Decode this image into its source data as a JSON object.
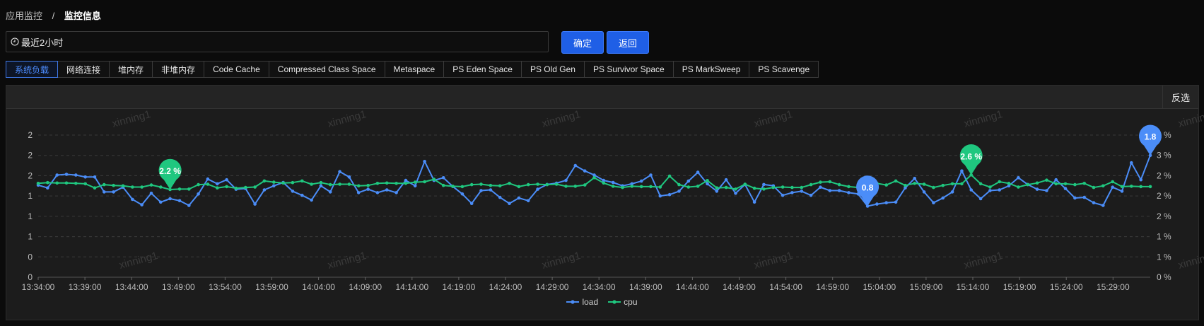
{
  "breadcrumb": {
    "parent": "应用监控",
    "separator": "/",
    "current": "监控信息"
  },
  "time_range": {
    "value": "最近2小时"
  },
  "buttons": {
    "confirm": "确定",
    "back": "返回"
  },
  "tabs": [
    {
      "label": "系统负载",
      "active": true
    },
    {
      "label": "网络连接"
    },
    {
      "label": "堆内存"
    },
    {
      "label": "非堆内存"
    },
    {
      "label": "Code Cache"
    },
    {
      "label": "Compressed Class Space"
    },
    {
      "label": "Metaspace"
    },
    {
      "label": "PS Eden Space"
    },
    {
      "label": "PS Old Gen"
    },
    {
      "label": "PS Survivor Space"
    },
    {
      "label": "PS MarkSweep"
    },
    {
      "label": "PS Scavenge"
    }
  ],
  "panel": {
    "invert_label": "反选"
  },
  "watermark": "xinning1",
  "chart_data": {
    "type": "line",
    "x_tick_labels": [
      "13:34:00",
      "13:39:00",
      "13:44:00",
      "13:49:00",
      "13:54:00",
      "13:59:00",
      "14:04:00",
      "14:09:00",
      "14:14:00",
      "14:19:00",
      "14:24:00",
      "14:29:00",
      "14:34:00",
      "14:39:00",
      "14:44:00",
      "14:49:00",
      "14:54:00",
      "14:59:00",
      "15:04:00",
      "15:09:00",
      "15:14:00",
      "15:19:00",
      "15:24:00",
      "15:29:00"
    ],
    "y_left_ticks": [
      "0",
      "0",
      "1",
      "1",
      "1",
      "2",
      "2",
      "2"
    ],
    "y_right_ticks": [
      "0 %",
      "1 %",
      "1 %",
      "2 %",
      "2 %",
      "2 %",
      "3 %",
      "3 %"
    ],
    "y_left_range": [
      0,
      2.1
    ],
    "y_right_range": [
      0,
      3.5
    ],
    "grid": true,
    "legend_position": "bottom-center",
    "series": [
      {
        "name": "load",
        "axis": "left",
        "color": "#4b8df8",
        "values": [
          1.36,
          1.32,
          1.51,
          1.52,
          1.51,
          1.48,
          1.48,
          1.26,
          1.26,
          1.33,
          1.15,
          1.07,
          1.24,
          1.11,
          1.16,
          1.13,
          1.06,
          1.23,
          1.45,
          1.38,
          1.44,
          1.3,
          1.31,
          1.08,
          1.29,
          1.35,
          1.4,
          1.27,
          1.21,
          1.14,
          1.35,
          1.26,
          1.56,
          1.48,
          1.25,
          1.3,
          1.25,
          1.29,
          1.25,
          1.43,
          1.35,
          1.71,
          1.43,
          1.47,
          1.34,
          1.23,
          1.09,
          1.28,
          1.29,
          1.18,
          1.09,
          1.17,
          1.13,
          1.3,
          1.37,
          1.39,
          1.43,
          1.65,
          1.57,
          1.51,
          1.43,
          1.4,
          1.35,
          1.38,
          1.42,
          1.51,
          1.2,
          1.22,
          1.27,
          1.42,
          1.55,
          1.38,
          1.27,
          1.44,
          1.24,
          1.37,
          1.11,
          1.37,
          1.35,
          1.21,
          1.25,
          1.27,
          1.21,
          1.33,
          1.28,
          1.28,
          1.25,
          1.23,
          1.05,
          1.08,
          1.1,
          1.11,
          1.32,
          1.46,
          1.26,
          1.1,
          1.17,
          1.26,
          1.57,
          1.29,
          1.16,
          1.28,
          1.29,
          1.35,
          1.47,
          1.37,
          1.3,
          1.28,
          1.44,
          1.31,
          1.17,
          1.18,
          1.1,
          1.06,
          1.33,
          1.27,
          1.69,
          1.44,
          1.8
        ]
      },
      {
        "name": "cpu",
        "axis": "right",
        "color": "#1fc77f",
        "values": [
          2.31,
          2.33,
          2.32,
          2.32,
          2.31,
          2.3,
          2.2,
          2.28,
          2.26,
          2.25,
          2.22,
          2.22,
          2.27,
          2.22,
          2.16,
          2.17,
          2.17,
          2.28,
          2.29,
          2.2,
          2.23,
          2.19,
          2.21,
          2.22,
          2.37,
          2.34,
          2.32,
          2.33,
          2.37,
          2.29,
          2.33,
          2.28,
          2.29,
          2.29,
          2.25,
          2.26,
          2.31,
          2.32,
          2.31,
          2.31,
          2.34,
          2.35,
          2.41,
          2.26,
          2.24,
          2.23,
          2.28,
          2.29,
          2.26,
          2.25,
          2.31,
          2.23,
          2.28,
          2.29,
          2.28,
          2.29,
          2.24,
          2.24,
          2.27,
          2.45,
          2.32,
          2.24,
          2.21,
          2.24,
          2.23,
          2.23,
          2.22,
          2.49,
          2.28,
          2.22,
          2.24,
          2.38,
          2.2,
          2.21,
          2.17,
          2.29,
          2.19,
          2.17,
          2.21,
          2.22,
          2.21,
          2.21,
          2.28,
          2.34,
          2.35,
          2.28,
          2.23,
          2.21,
          2.21,
          2.31,
          2.27,
          2.37,
          2.26,
          2.31,
          2.29,
          2.21,
          2.26,
          2.3,
          2.3,
          2.52,
          2.3,
          2.22,
          2.35,
          2.31,
          2.22,
          2.28,
          2.32,
          2.39,
          2.3,
          2.3,
          2.28,
          2.31,
          2.21,
          2.25,
          2.35,
          2.23,
          2.24,
          2.23,
          2.23
        ]
      }
    ],
    "markers": [
      {
        "series": "cpu",
        "type": "max",
        "label": "2.6 %"
      },
      {
        "series": "cpu",
        "type": "min",
        "label": "2.2 %"
      },
      {
        "series": "load",
        "type": "max",
        "label": "1.8"
      },
      {
        "series": "load",
        "type": "min",
        "label": "0.8"
      }
    ]
  }
}
